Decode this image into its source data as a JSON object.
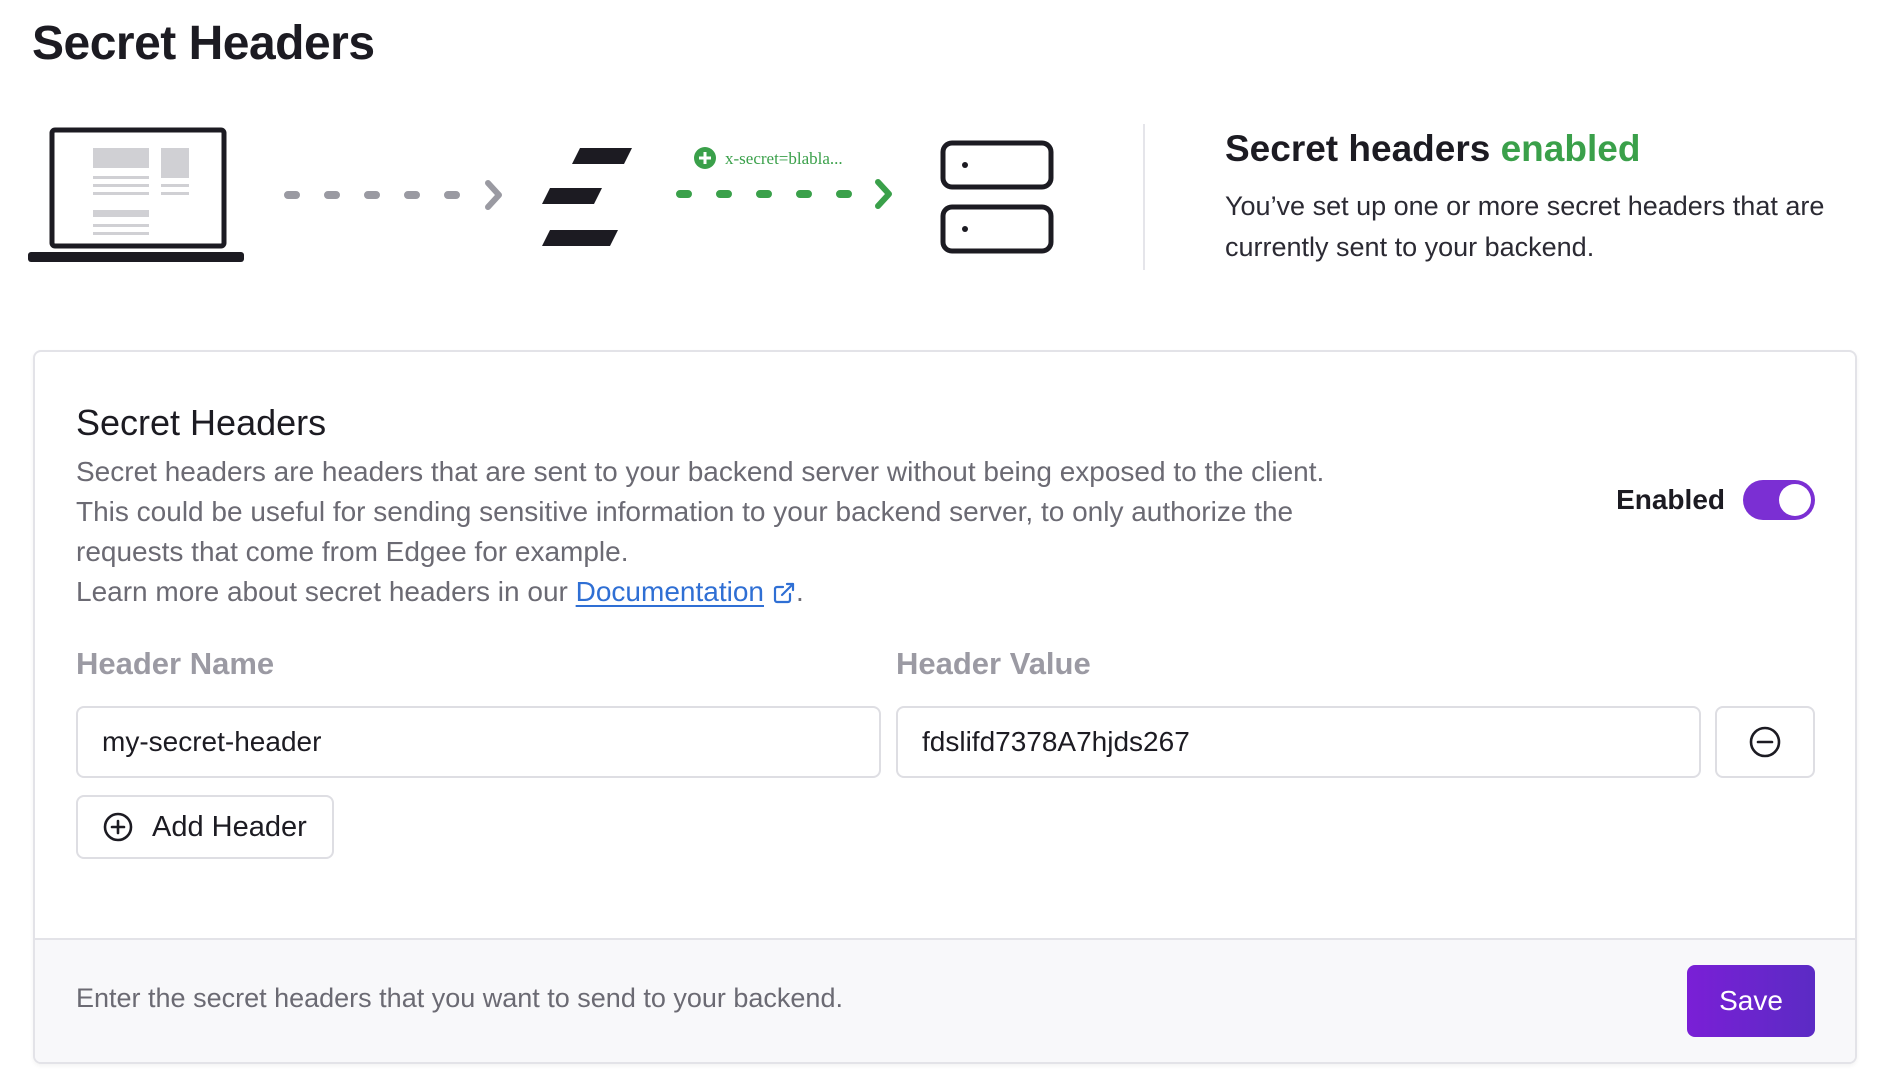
{
  "page": {
    "title": "Secret Headers"
  },
  "illustration": {
    "header_tag": "x-secret=blabla..."
  },
  "status": {
    "title_prefix": "Secret headers",
    "title_state": "enabled",
    "description": "You’ve set up one or more secret headers that are currently sent to your backend.",
    "state_color": "#3aa04a"
  },
  "card": {
    "title": "Secret Headers",
    "description": "Secret headers are headers that are sent to your backend server without being exposed to the client. This could be useful for sending sensitive information to your backend server, to only authorize the requests that come from Edgee for example.",
    "learn_more_prefix": "Learn more about secret headers in our",
    "doc_link_label": "Documentation",
    "learn_more_suffix": ".",
    "toggle": {
      "label": "Enabled",
      "on": true,
      "color": "#7b2fd3"
    },
    "columns": {
      "name_label": "Header Name",
      "value_label": "Header Value"
    },
    "headers": [
      {
        "name": "my-secret-header",
        "value": "fdslifd7378A7hjds267"
      }
    ],
    "add_label": "Add Header",
    "footer_text": "Enter the secret headers that you want to send to your backend.",
    "save_label": "Save"
  },
  "icons": {
    "external_link": "external-link-icon",
    "remove": "minus-circle-icon",
    "add": "plus-circle-icon"
  }
}
